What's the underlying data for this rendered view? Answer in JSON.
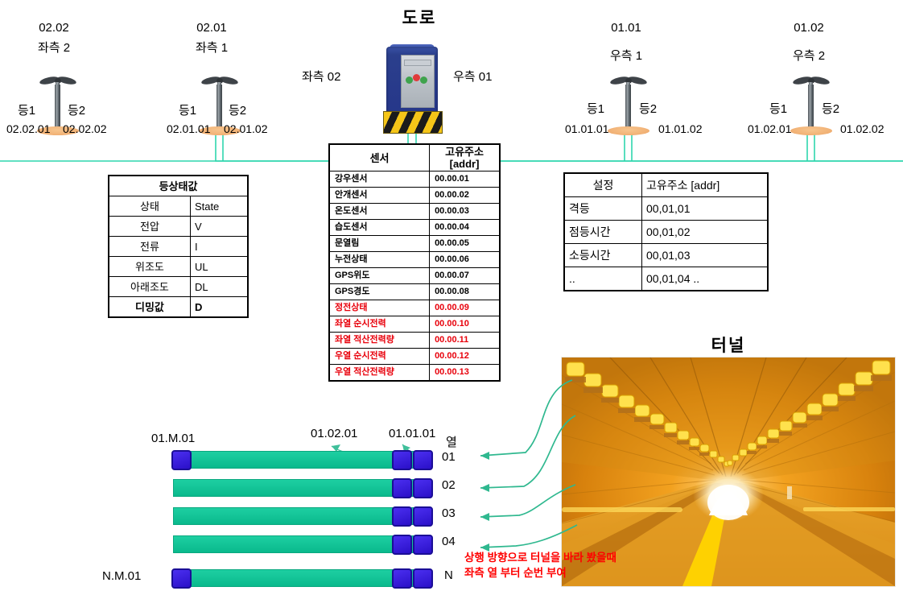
{
  "titles": {
    "road": "도로",
    "tunnel": "터널"
  },
  "poles": [
    {
      "id": "02.02",
      "side": "좌측 2",
      "lamp1": "등1",
      "lamp2": "등2",
      "addr1": "02.02.01",
      "addr2": "02.02.02"
    },
    {
      "id": "02.01",
      "side": "좌측 1",
      "lamp1": "등1",
      "lamp2": "등2",
      "addr1": "02.01.01",
      "addr2": "02.01.02"
    },
    {
      "id": "01.01",
      "side": "우측 1",
      "lamp1": "등1",
      "lamp2": "등2",
      "addr1": "01.01.01",
      "addr2": "01.01.02"
    },
    {
      "id": "01.02",
      "side": "우측 2",
      "lamp1": "등1",
      "lamp2": "등2",
      "addr1": "01.02.01",
      "addr2": "01.02.02"
    }
  ],
  "cabinet": {
    "left_label": "좌측 02",
    "right_label": "우측 01"
  },
  "lamp_state_table": {
    "title": "등상태값",
    "rows": [
      {
        "name": "상태",
        "value": "State"
      },
      {
        "name": "전압",
        "value": "V"
      },
      {
        "name": "전류",
        "value": "I"
      },
      {
        "name": "위조도",
        "value": "UL"
      },
      {
        "name": "아래조도",
        "value": "DL"
      },
      {
        "name": "디밍값",
        "value": "D"
      }
    ]
  },
  "sensor_table": {
    "header": {
      "col1": "센서",
      "col2": "고유주소",
      "col2_sub": "[addr]"
    },
    "rows": [
      {
        "name": "강우센서",
        "addr": "00.00.01",
        "red": false
      },
      {
        "name": "안개센서",
        "addr": "00.00.02",
        "red": false
      },
      {
        "name": "온도센서",
        "addr": "00.00.03",
        "red": false
      },
      {
        "name": "습도센서",
        "addr": "00.00.04",
        "red": false
      },
      {
        "name": "문열림",
        "addr": "00.00.05",
        "red": false
      },
      {
        "name": "누전상태",
        "addr": "00.00.06",
        "red": false
      },
      {
        "name": "GPS위도",
        "addr": "00.00.07",
        "red": false
      },
      {
        "name": "GPS경도",
        "addr": "00.00.08",
        "red": false
      },
      {
        "name": "정전상태",
        "addr": "00.00.09",
        "red": true
      },
      {
        "name": "좌열 순시전력",
        "addr": "00.00.10",
        "red": true
      },
      {
        "name": "좌열 적산전력량",
        "addr": "00.00.11",
        "red": true
      },
      {
        "name": "우열 순시전력",
        "addr": "00.00.12",
        "red": true
      },
      {
        "name": "우열 적산전력량",
        "addr": "00.00.13",
        "red": true
      }
    ]
  },
  "setting_table": {
    "header": {
      "col1": "설정",
      "col2": "고유주소 [addr]"
    },
    "rows": [
      {
        "name": "격등",
        "addr": "00,01,01"
      },
      {
        "name": "점등시간",
        "addr": "00,01,02"
      },
      {
        "name": "소등시간",
        "addr": "00,01,03"
      },
      {
        "name": "..",
        "addr": "00,01,04 .."
      }
    ]
  },
  "grid": {
    "col_label": "열",
    "left_first_label": "01.M.01",
    "left_last_label": "N.M.01",
    "top_label_left": "01.02.01",
    "top_label_right": "01.01.01",
    "rows": [
      {
        "label": "01",
        "left_square": true
      },
      {
        "label": "02",
        "left_square": false
      },
      {
        "label": "03",
        "left_square": false
      },
      {
        "label": "04",
        "left_square": false
      },
      {
        "label": "N",
        "left_square": true
      }
    ],
    "note_line1": "상행 방향으로 터널을 바라 봤을때",
    "note_line2": "좌측 열 부터 순번 부여"
  },
  "colors": {
    "bus_line": "#2fd6ad",
    "bar": "#13c296",
    "square": "#3a20e0",
    "red_text": "#ff0000",
    "table_red": "#e8000b"
  }
}
